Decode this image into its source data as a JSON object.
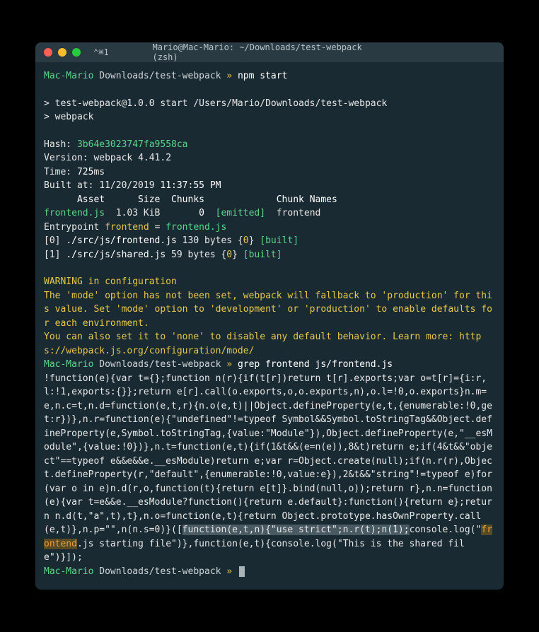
{
  "titlebar": {
    "cmd_hint": "⌃⌘1",
    "title": "Mario@Mac-Mario: ~/Downloads/test-webpack (zsh)"
  },
  "prompt1": {
    "host": "Mac-Mario",
    "path": "Downloads/test-webpack",
    "sep": "»",
    "cmd": "npm start"
  },
  "npm_run": {
    "line1": "> test-webpack@1.0.0 start /Users/Mario/Downloads/test-webpack",
    "line2": "> webpack"
  },
  "build": {
    "hash_label": "Hash: ",
    "hash_val": "3b64e3023747fa9558ca",
    "version_label": "Version: ",
    "version_val": "webpack ",
    "version_num": "4.41.2",
    "time_label": "Time: ",
    "time_val": "725",
    "time_unit": "ms",
    "built_at_label": "Built at: 11/20/2019 ",
    "built_at_time": "11:37:55 PM",
    "header": "      Asset      Size  Chunks             Chunk Names",
    "asset_name": "frontend.js",
    "asset_size": "  1.03 KiB       ",
    "asset_chunk": "0",
    "asset_emitted": "[emitted]",
    "asset_chunkname": "  frontend",
    "entry_label": "Entrypoint ",
    "entry_name": "frontend",
    "entry_eq": " = ",
    "entry_file": "frontend.js",
    "mod0_idx": "[0] ",
    "mod0_path": "./src/js/frontend.js",
    "mod0_size": " 130 bytes {",
    "mod0_chunk": "0",
    "mod0_close": "} ",
    "mod0_built": "[built]",
    "mod1_idx": "[1] ",
    "mod1_path": "./src/js/shared.js",
    "mod1_size": " 59 bytes {",
    "mod1_chunk": "0",
    "mod1_close": "} ",
    "mod1_built": "[built]"
  },
  "warning": {
    "header": "WARNING in configuration",
    "body1": "The 'mode' option has not been set, webpack will fallback to 'production' for this value. Set 'mode' option to 'development' or 'production' to enable defaults for each environment.",
    "body2": "You can also set it to 'none' to disable any default behavior. Learn more: https://webpack.js.org/configuration/mode/"
  },
  "prompt2": {
    "host": "Mac-Mario",
    "path": "Downloads/test-webpack",
    "sep": "»",
    "cmd": "grep frontend js/frontend.js"
  },
  "grep": {
    "seg1": "!function(e){var t={};function n(r){if(t[r])return t[r].exports;var o=t[r]={i:r,l:!1,exports:{}};return e[r].call(o.exports,o,o.exports,n),o.l=!0,o.exports}n.m=e,n.c=t,n.d=function(e,t,r){n.o(e,t)||Object.defineProperty(e,t,{enumerable:!0,get:r})},n.r=function(e){\"undefined\"!=typeof Symbol&&Symbol.toStringTag&&Object.defineProperty(e,Symbol.toStringTag,{value:\"Module\"}),Object.defineProperty(e,\"__esModule\",{value:!0})},n.t=function(e,t){if(1&t&&(e=n(e)),8&t)return e;if(4&t&&\"object\"==typeof e&&e&&e.__esModule)return e;var r=Object.create(null);if(n.r(r),Object.defineProperty(r,\"default\",{enumerable:!0,value:e}),2&t&&\"string\"!=typeof e)for(var o in e)n.d(r,o,function(t){return e[t]}.bind(null,o));return r},n.n=function(e){var t=e&&e.__esModule?function(){return e.default}:function(){return e};return n.d(t,\"a\",t),t},n.o=function(e,t){return Object.prototype.hasOwnProperty.call(e,t)},n.p=\"\",n(n.s=0)}([",
    "hl1": "function(e,t,n){\"use strict\";n.r(t);n(1);",
    "seg2": "console.log(\"",
    "match": "frontend",
    "seg3": ".js starting file\")},function(e,t){console.log(\"This is the shared file\")}]);"
  },
  "prompt3": {
    "host": "Mac-Mario",
    "path": "Downloads/test-webpack",
    "sep": "»"
  }
}
